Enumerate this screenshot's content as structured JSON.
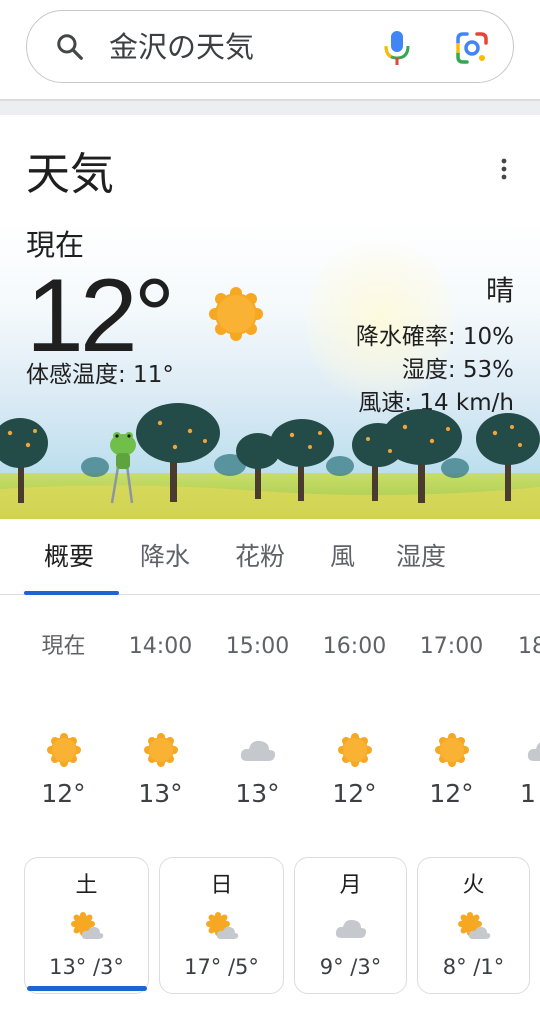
{
  "search": {
    "query": "金沢の天気"
  },
  "card": {
    "title": "天気"
  },
  "current": {
    "label": "現在",
    "temp": "12°",
    "feels_like": "体感温度: 11°",
    "condition": "晴",
    "precip": "降水確率: 10%",
    "humidity": "湿度: 53%",
    "wind": "風速: 14 km/h",
    "icon": "sunny-icon"
  },
  "tabs": [
    {
      "label": "概要"
    },
    {
      "label": "降水"
    },
    {
      "label": "花粉"
    },
    {
      "label": "風"
    },
    {
      "label": "湿度"
    }
  ],
  "hourly": [
    {
      "time": "現在",
      "icon": "sunny-icon",
      "temp": "12°"
    },
    {
      "time": "14:00",
      "icon": "sunny-icon",
      "temp": "13°"
    },
    {
      "time": "15:00",
      "icon": "cloudy-icon",
      "temp": "13°"
    },
    {
      "time": "16:00",
      "icon": "sunny-icon",
      "temp": "12°"
    },
    {
      "time": "17:00",
      "icon": "sunny-icon",
      "temp": "12°"
    },
    {
      "time": "18",
      "icon": "cloudy-icon",
      "temp": "1"
    }
  ],
  "daily": [
    {
      "day": "土",
      "icon": "partly-cloudy-icon",
      "temps": "13° /3°"
    },
    {
      "day": "日",
      "icon": "partly-cloudy-icon",
      "temps": "17° /5°"
    },
    {
      "day": "月",
      "icon": "cloudy-icon",
      "temps": "9° /3°"
    },
    {
      "day": "火",
      "icon": "partly-cloudy-icon",
      "temps": "8° /1°"
    }
  ],
  "colors": {
    "accent": "#1a66d2",
    "sun": "#f5a524",
    "cloud": "#c5c8cc"
  }
}
